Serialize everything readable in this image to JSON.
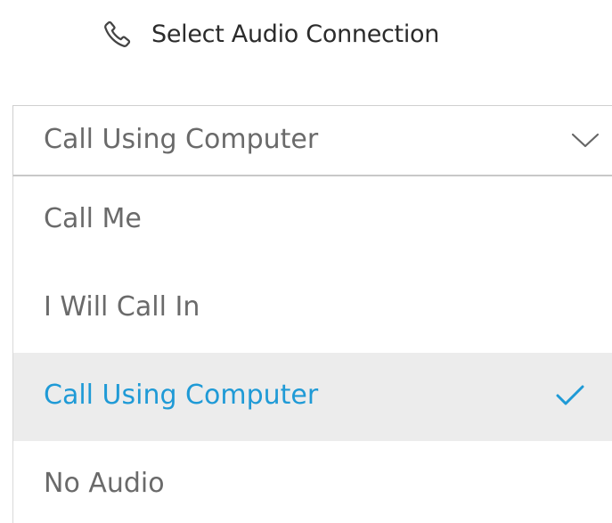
{
  "header": {
    "title": "Select Audio Connection",
    "icon": "phone-icon"
  },
  "select": {
    "value": "Call Using Computer",
    "icon": "chevron-down-icon"
  },
  "options": [
    {
      "label": "Call Me",
      "selected": false
    },
    {
      "label": "I Will Call In",
      "selected": false
    },
    {
      "label": "Call Using Computer",
      "selected": true
    },
    {
      "label": "No Audio",
      "selected": false
    }
  ],
  "colors": {
    "accent": "#1f9ad6",
    "selected_bg": "#ececec",
    "text_muted": "#6a6a6a",
    "title_text": "#2b2b2b"
  }
}
